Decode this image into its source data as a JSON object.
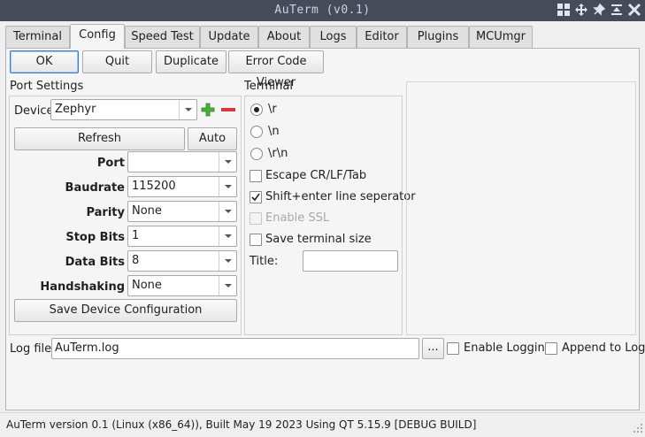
{
  "window": {
    "title": "AuTerm (v0.1)"
  },
  "tabs": [
    "Terminal",
    "Config",
    "Speed Test",
    "Update",
    "About",
    "Logs",
    "Editor",
    "Plugins",
    "MCUmgr"
  ],
  "toolbar": {
    "ok": "OK",
    "quit": "Quit",
    "duplicate": "Duplicate",
    "error_code_viewer": "Error Code Viewer"
  },
  "port_settings": {
    "title": "Port Settings",
    "device_label": "Device",
    "device_value": "Zephyr",
    "refresh": "Refresh",
    "auto": "Auto",
    "port_label": "Port",
    "port_value": "",
    "baudrate_label": "Baudrate",
    "baudrate_value": "115200",
    "parity_label": "Parity",
    "parity_value": "None",
    "stop_bits_label": "Stop Bits",
    "stop_bits_value": "1",
    "data_bits_label": "Data Bits",
    "data_bits_value": "8",
    "handshaking_label": "Handshaking",
    "handshaking_value": "None",
    "save": "Save Device Configuration"
  },
  "terminal": {
    "title": "Terminal",
    "radio_r": "\\r",
    "radio_n": "\\n",
    "radio_rn": "\\r\\n",
    "escape": "Escape CR/LF/Tab",
    "shift_enter": "Shift+enter line seperator",
    "enable_ssl": "Enable SSL",
    "save_size": "Save terminal size",
    "title_label": "Title:",
    "title_value": ""
  },
  "log": {
    "label": "Log file:",
    "value": "AuTerm.log",
    "browse": "...",
    "enable_logging": "Enable Logging",
    "append": "Append to Log"
  },
  "status": {
    "text": "AuTerm version 0.1 (Linux (x86_64)), Built May 19 2023 Using QT 5.15.9 [DEBUG BUILD]"
  },
  "colors": {
    "titlebar": "#454b58",
    "accent": "#3e7dc9",
    "add_icon": "#4caf3c",
    "remove_icon": "#d83a3a"
  }
}
